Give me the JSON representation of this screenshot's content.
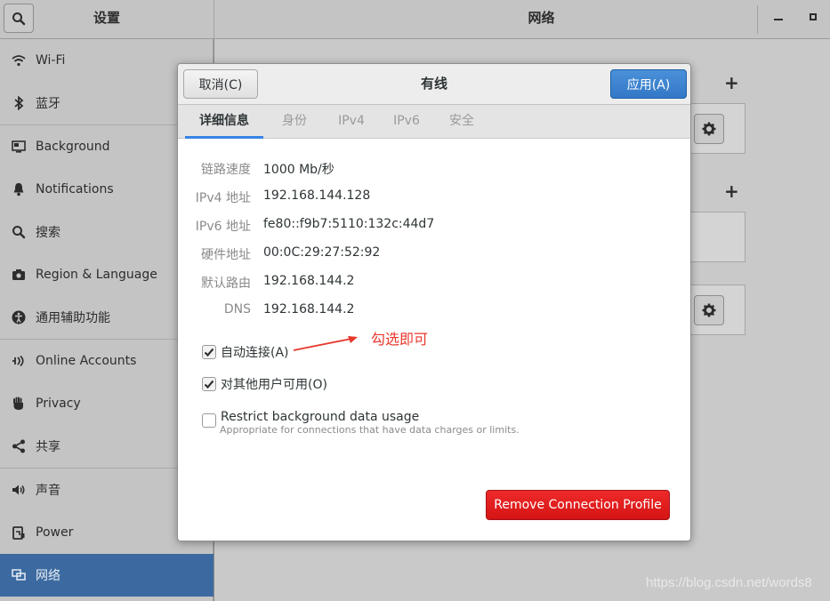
{
  "header": {
    "left_title": "设置",
    "right_title": "网络"
  },
  "sidebar": {
    "items": [
      {
        "label": "Wi-Fi",
        "icon": "wifi-icon"
      },
      {
        "label": "蓝牙",
        "icon": "bluetooth-icon"
      },
      {
        "label": "Background",
        "icon": "background-icon"
      },
      {
        "label": "Notifications",
        "icon": "bell-icon"
      },
      {
        "label": "搜索",
        "icon": "search-icon"
      },
      {
        "label": "Region & Language",
        "icon": "camera-icon"
      },
      {
        "label": "通用辅助功能",
        "icon": "accessibility-icon"
      },
      {
        "label": "Online Accounts",
        "icon": "online-accounts-icon"
      },
      {
        "label": "Privacy",
        "icon": "hand-icon"
      },
      {
        "label": "共享",
        "icon": "share-icon"
      },
      {
        "label": "声音",
        "icon": "speaker-icon"
      },
      {
        "label": "Power",
        "icon": "power-icon"
      },
      {
        "label": "网络",
        "icon": "network-icon"
      }
    ],
    "active_index": 12
  },
  "dialog": {
    "title": "有线",
    "cancel_label": "取消(C)",
    "apply_label": "应用(A)",
    "tabs": [
      {
        "label": "详细信息",
        "active": true
      },
      {
        "label": "身份",
        "active": false
      },
      {
        "label": "IPv4",
        "active": false
      },
      {
        "label": "IPv6",
        "active": false
      },
      {
        "label": "安全",
        "active": false
      }
    ],
    "details": [
      {
        "label": "链路速度",
        "value": "1000 Mb/秒"
      },
      {
        "label": "IPv4 地址",
        "value": "192.168.144.128"
      },
      {
        "label": "IPv6 地址",
        "value": "fe80::f9b7:5110:132c:44d7"
      },
      {
        "label": "硬件地址",
        "value": "00:0C:29:27:52:92"
      },
      {
        "label": "默认路由",
        "value": "192.168.144.2"
      },
      {
        "label": "DNS",
        "value": "192.168.144.2"
      }
    ],
    "checkboxes": [
      {
        "label": "自动连接(A)",
        "checked": true
      },
      {
        "label": "对其他用户可用(O)",
        "checked": true
      },
      {
        "label": "Restrict background data usage",
        "checked": false,
        "description": "Appropriate for connections that have data charges or limits."
      }
    ],
    "remove_label": "Remove Connection Profile"
  },
  "annotation": {
    "text": "勾选即可",
    "color": "#e8372c"
  },
  "watermark": "https://blog.csdn.net/words8",
  "colors": {
    "accent": "#3584e4",
    "sidebar_active": "#3c6aa0",
    "destructive": "#e01b24"
  }
}
